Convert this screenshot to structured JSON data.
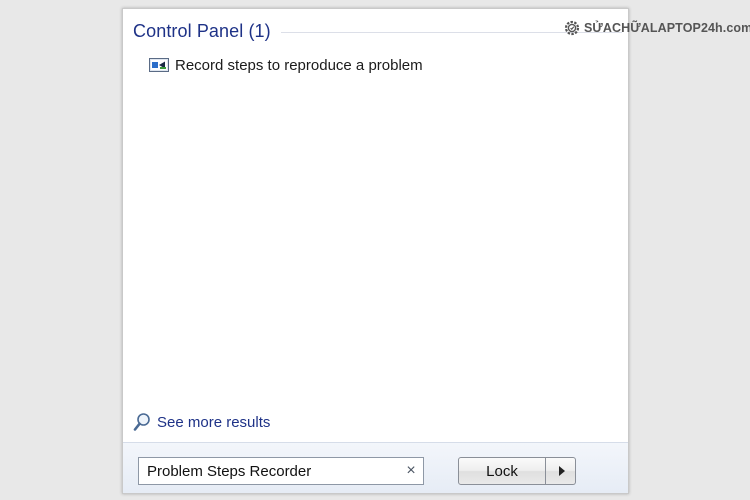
{
  "control_panel": {
    "section_title": "Control Panel (1)",
    "results": [
      {
        "label": "Record steps to reproduce a problem",
        "icon": "steps-recorder-icon"
      }
    ]
  },
  "see_more": {
    "label": "See more results",
    "icon": "magnifier-icon"
  },
  "search": {
    "value": "Problem Steps Recorder",
    "clear_glyph": "×"
  },
  "power": {
    "lock_label": "Lock"
  },
  "watermark": {
    "text": "SỬACHỮALAPTOP24h.com"
  },
  "colors": {
    "section_title": "#1e3287",
    "link": "#1e3287",
    "page_background": "#e8e8e8",
    "menu_background": "#ffffff"
  }
}
